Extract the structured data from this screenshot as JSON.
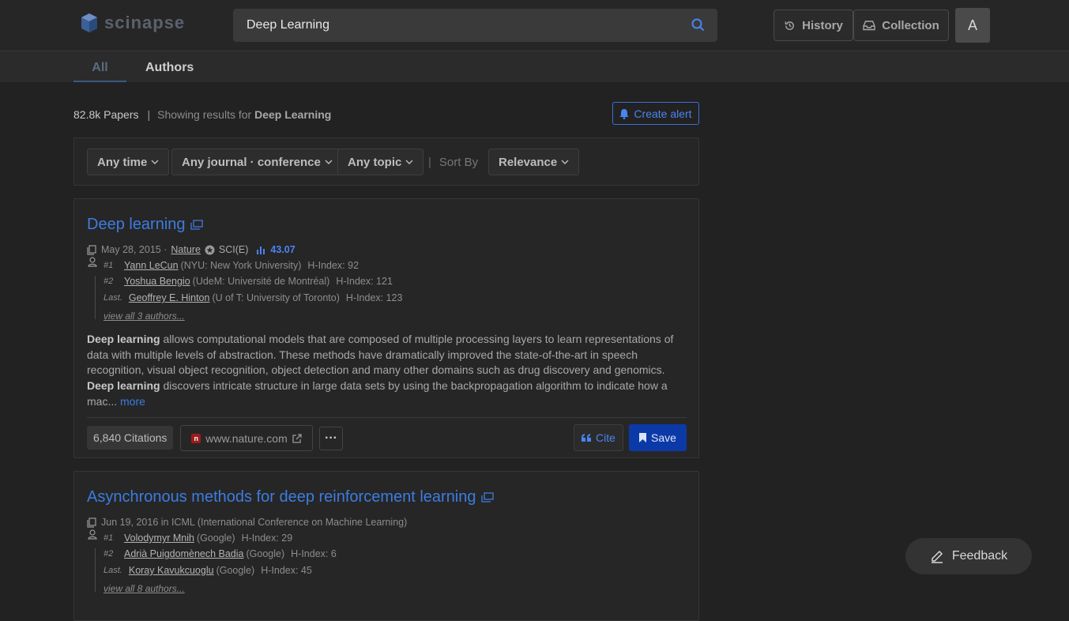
{
  "header": {
    "logo_text": "scinapse",
    "search_value": "Deep Learning",
    "history_label": "History",
    "collection_label": "Collection",
    "avatar_letter": "A"
  },
  "tabs": [
    {
      "label": "All",
      "active": true
    },
    {
      "label": "Authors",
      "active": false
    }
  ],
  "summary": {
    "count": "82.8k Papers",
    "separator": "|",
    "showing_prefix": "Showing results for",
    "query": "Deep Learning",
    "alert_label": "Create alert"
  },
  "filters": {
    "time": "Any time",
    "journal": "Any journal · conference",
    "topic": "Any topic",
    "separator": "|",
    "sort_label": "Sort By",
    "sort_value": "Relevance"
  },
  "papers": [
    {
      "title": "Deep learning",
      "date": "May 28, 2015 ·",
      "venue": "Nature",
      "index": "SCI(E)",
      "score": "43.07",
      "authors": [
        {
          "rank": "#1",
          "name": "Yann LeCun",
          "affil": "(NYU: New York University)",
          "hindex": "H-Index: 92"
        },
        {
          "rank": "#2",
          "name": "Yoshua Bengio",
          "affil": "(UdeM: Université de Montréal)",
          "hindex": "H-Index: 121"
        },
        {
          "rank": "Last.",
          "name": "Geoffrey E. Hinton",
          "affil": "(U of T: University of Toronto)",
          "hindex": "H-Index: 123"
        }
      ],
      "view_all": "view all 3 authors...",
      "abstract": {
        "p1_bold": "Deep learning",
        "p1": " allows computational models that are composed of multiple processing layers to learn representations of data with multiple levels of abstraction. These methods have dramatically improved the state-of-the-art in speech recognition, visual object recognition, object detection and many other domains such as drug discovery and genomics.",
        "p2_bold": "Deep learning",
        "p2": " discovers intricate structure in large data sets by using the backpropagation algorithm to indicate how a mac...",
        "more": "more"
      },
      "citations": "6,840 Citations",
      "source_badge": "n",
      "source": "www.nature.com",
      "more_menu": "···",
      "cite_label": "Cite",
      "save_label": "Save"
    },
    {
      "title": "Asynchronous methods for deep reinforcement learning",
      "date": "Jun 19, 2016 in ICML (International Conference on Machine Learning)",
      "authors": [
        {
          "rank": "#1",
          "name": "Volodymyr Mnih",
          "affil": "(Google)",
          "hindex": "H-Index: 29"
        },
        {
          "rank": "#2",
          "name": "Adrià Puigdomènech Badia",
          "affil": "(Google)",
          "hindex": "H-Index: 6"
        },
        {
          "rank": "Last.",
          "name": "Koray Kavukcuoglu",
          "affil": "(Google)",
          "hindex": "H-Index: 45"
        }
      ],
      "view_all": "view all 8 authors..."
    }
  ],
  "feedback_label": "Feedback",
  "colors": {
    "accent": "#3d7ce0",
    "save_bg": "#0b3aa8",
    "background": "#222222"
  }
}
